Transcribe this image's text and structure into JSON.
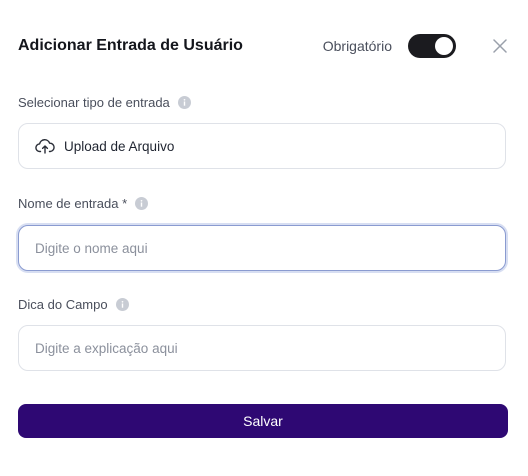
{
  "header": {
    "title": "Adicionar Entrada de Usuário",
    "required_label": "Obrigatório",
    "required_on": true,
    "close_icon": "close-icon"
  },
  "input_type": {
    "label": "Selecionar tipo de entrada",
    "info_icon": "info-icon",
    "value": "Upload de Arquivo",
    "value_icon": "cloud-upload-icon"
  },
  "input_name": {
    "label": "Nome de entrada *",
    "info_icon": "info-icon",
    "value": "",
    "placeholder": "Digite o nome aqui"
  },
  "field_hint": {
    "label": "Dica do Campo",
    "info_icon": "info-icon",
    "value": "",
    "placeholder": "Digite a explicação aqui"
  },
  "save_button": {
    "label": "Salvar"
  },
  "colors": {
    "primary": "#2e0873",
    "toggle_on": "#1b1b1f",
    "focus_border": "#8a9bd0"
  }
}
